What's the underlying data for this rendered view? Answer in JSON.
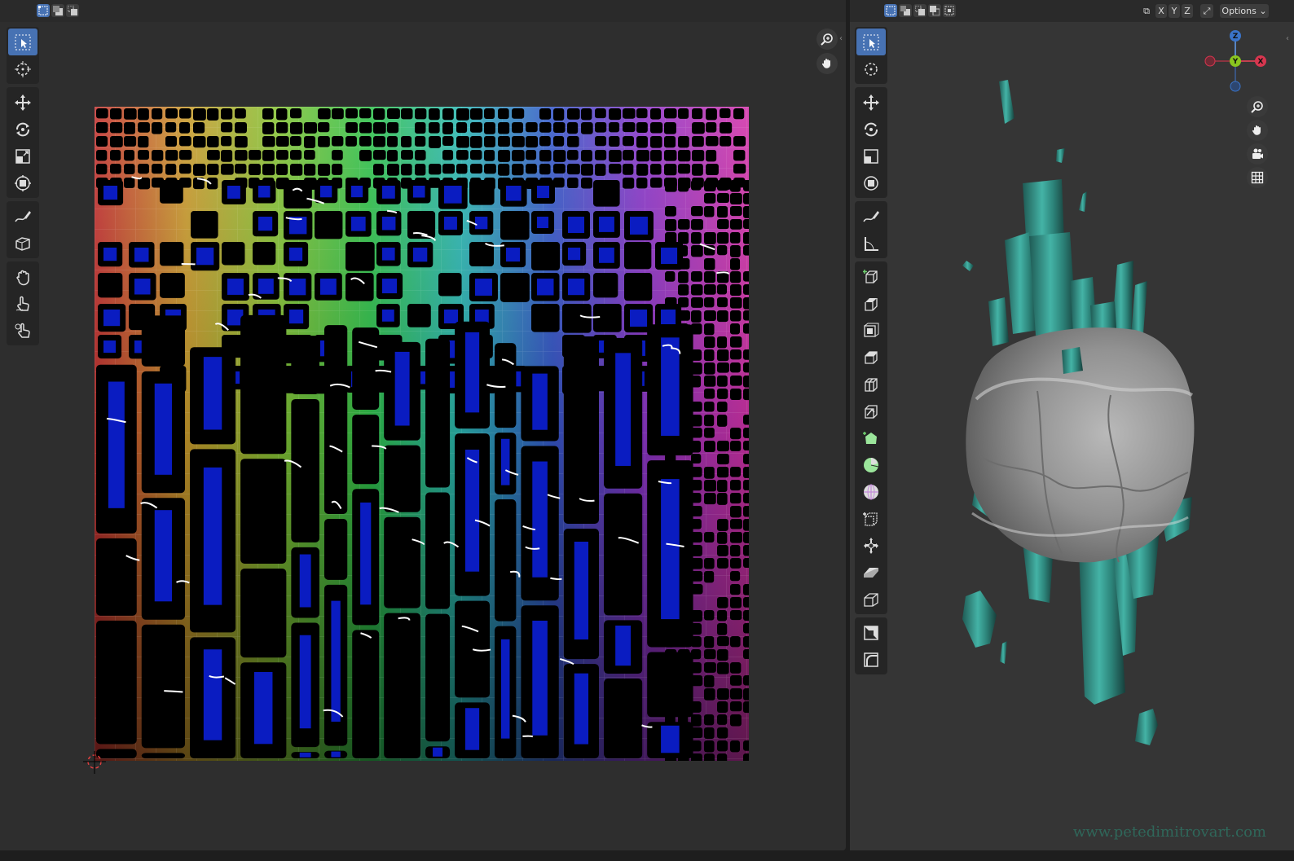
{
  "uv_editor": {
    "selection_modes": [
      "vertex-select",
      "edge-select",
      "face-select"
    ],
    "active_selection_mode": "vertex-select",
    "tools": [
      {
        "name": "select-box",
        "icon": "select-box-icon",
        "active": true
      },
      {
        "name": "cursor",
        "icon": "cursor-icon"
      },
      {
        "name": "move",
        "icon": "move-icon"
      },
      {
        "name": "rotate",
        "icon": "rotate-icon"
      },
      {
        "name": "scale",
        "icon": "scale-icon"
      },
      {
        "name": "transform",
        "icon": "transform-icon"
      },
      {
        "name": "annotate",
        "icon": "annotate-icon"
      },
      {
        "name": "rip",
        "icon": "rip-icon"
      },
      {
        "name": "grab",
        "icon": "grab-icon"
      },
      {
        "name": "relax",
        "icon": "relax-icon"
      },
      {
        "name": "pinch",
        "icon": "pinch-icon"
      }
    ],
    "navigation": [
      "zoom-icon",
      "pan-icon"
    ],
    "texture": "uv-checker-color-grid"
  },
  "viewport_3d": {
    "selection_modes": [
      "vertex-select",
      "edge-select",
      "face-select",
      "extend-select",
      "subtract-select"
    ],
    "header": {
      "axis_x": "X",
      "axis_y": "Y",
      "axis_z": "Z",
      "options_label": "Options"
    },
    "gizmo": {
      "x": "X",
      "y": "Y",
      "z": "Z"
    },
    "tools": [
      "select-box-icon",
      "cursor-icon",
      "move-icon",
      "rotate-icon",
      "scale-icon",
      "transform-icon",
      "annotate-icon",
      "measure-icon",
      "add-cube-icon",
      "extrude-icon",
      "inset-icon",
      "bevel-icon",
      "loop-cut-icon",
      "knife-icon",
      "poly-build-icon",
      "spin-icon",
      "smooth-icon",
      "edge-slide-icon",
      "shrink-fatten-icon",
      "shear-icon",
      "rip-region-icon",
      "to-sphere-icon",
      "rip-edge-icon"
    ],
    "navigation": [
      "zoom-icon",
      "pan-icon",
      "camera-icon",
      "grid-icon"
    ],
    "colors": {
      "crystal": "#3fa69a",
      "rock": "#9a9a9a",
      "background": "#353535"
    }
  },
  "watermark": "www.petedimitrovart.com"
}
